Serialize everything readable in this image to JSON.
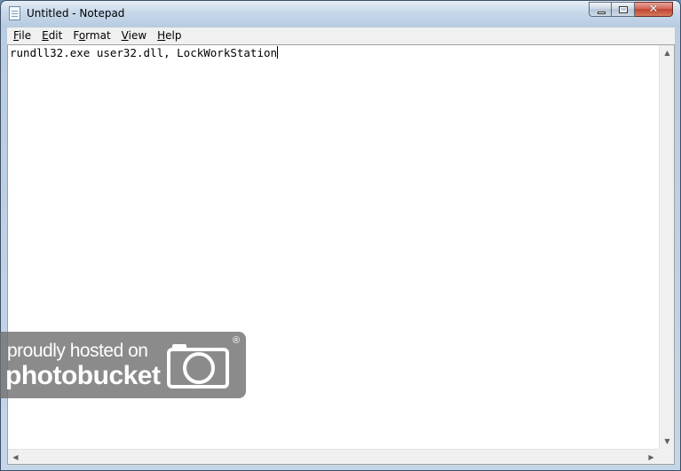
{
  "window": {
    "title": "Untitled - Notepad"
  },
  "caption_buttons": {
    "minimize_glyph": "",
    "close_glyph": "✕"
  },
  "menu": [
    {
      "label": "File",
      "accel": "F"
    },
    {
      "label": "Edit",
      "accel": "E"
    },
    {
      "label": "Format",
      "accel": "o"
    },
    {
      "label": "View",
      "accel": "V"
    },
    {
      "label": "Help",
      "accel": "H"
    }
  ],
  "editor": {
    "content": "rundll32.exe user32.dll, LockWorkStation"
  },
  "watermark": {
    "line1": "proudly hosted on",
    "line2": "photobucket",
    "reg": "®"
  },
  "icons": [
    "notepad-icon",
    "minimize-icon",
    "maximize-icon",
    "close-icon",
    "scroll-up-icon",
    "scroll-down-icon",
    "scroll-left-icon",
    "scroll-right-icon",
    "camera-logo"
  ]
}
